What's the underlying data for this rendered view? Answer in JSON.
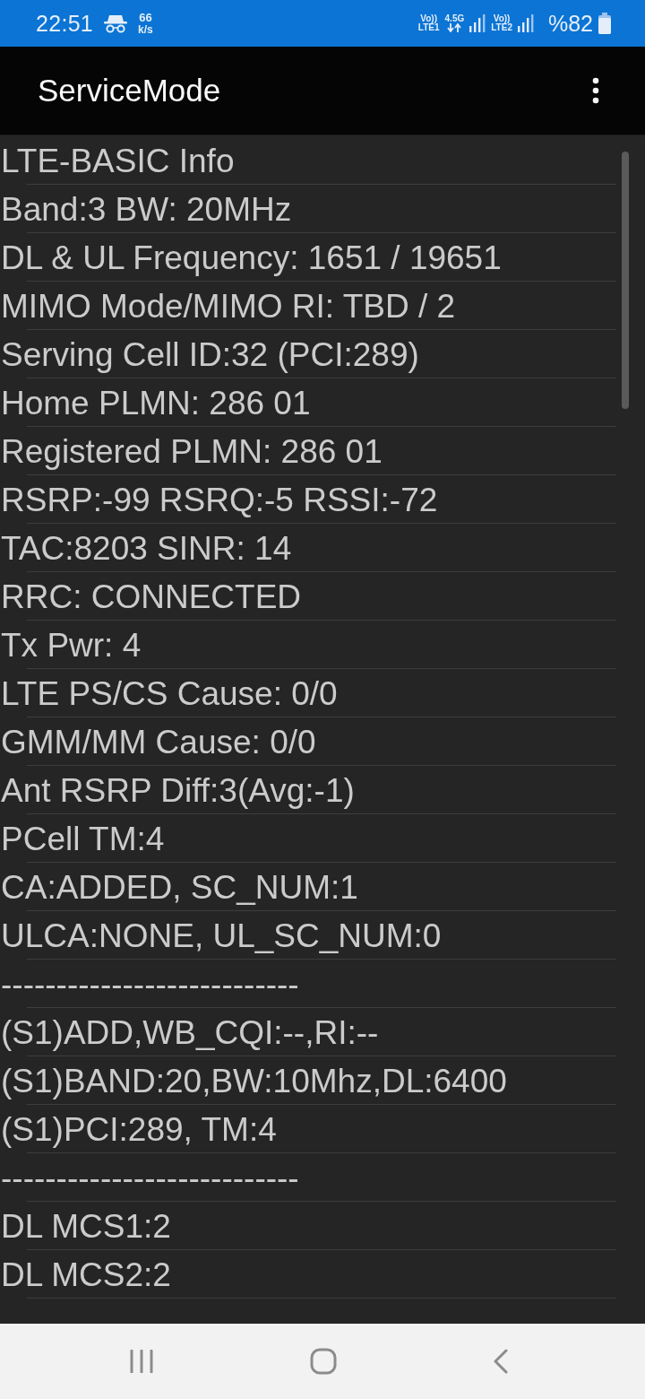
{
  "status_bar": {
    "time": "22:51",
    "speed": {
      "value": "66",
      "unit": "k/s"
    },
    "sim1": {
      "volte": "Vo))",
      "label": "LTE1"
    },
    "network": "4.5G",
    "sim2": {
      "volte": "Vo))",
      "label": "LTE2"
    },
    "battery": "%82"
  },
  "app_bar": {
    "title": "ServiceMode"
  },
  "info_list": {
    "items": [
      {
        "text": "LTE-BASIC Info"
      },
      {
        "text": "Band:3 BW: 20MHz"
      },
      {
        "text": "DL & UL Frequency: 1651 / 19651"
      },
      {
        "text": "MIMO Mode/MIMO RI: TBD / 2"
      },
      {
        "text": "Serving Cell ID:32 (PCI:289)"
      },
      {
        "text": "Home PLMN: 286 01"
      },
      {
        "text": "Registered PLMN: 286 01"
      },
      {
        "text": "RSRP:-99 RSRQ:-5 RSSI:-72"
      },
      {
        "text": "TAC:8203 SINR: 14"
      },
      {
        "text": "RRC: CONNECTED"
      },
      {
        "text": "Tx Pwr: 4"
      },
      {
        "text": "LTE PS/CS Cause: 0/0"
      },
      {
        "text": "GMM/MM Cause: 0/0"
      },
      {
        "text": "Ant RSRP Diff:3(Avg:-1)"
      },
      {
        "text": "PCell TM:4"
      },
      {
        "text": "CA:ADDED, SC_NUM:1"
      },
      {
        "text": "ULCA:NONE, UL_SC_NUM:0"
      },
      {
        "text": "---------------------------"
      },
      {
        "text": "(S1)ADD,WB_CQI:--,RI:--"
      },
      {
        "text": "(S1)BAND:20,BW:10Mhz,DL:6400"
      },
      {
        "text": "(S1)PCI:289, TM:4"
      },
      {
        "text": "---------------------------"
      },
      {
        "text": "DL MCS1:2"
      },
      {
        "text": "DL MCS2:2"
      }
    ]
  }
}
